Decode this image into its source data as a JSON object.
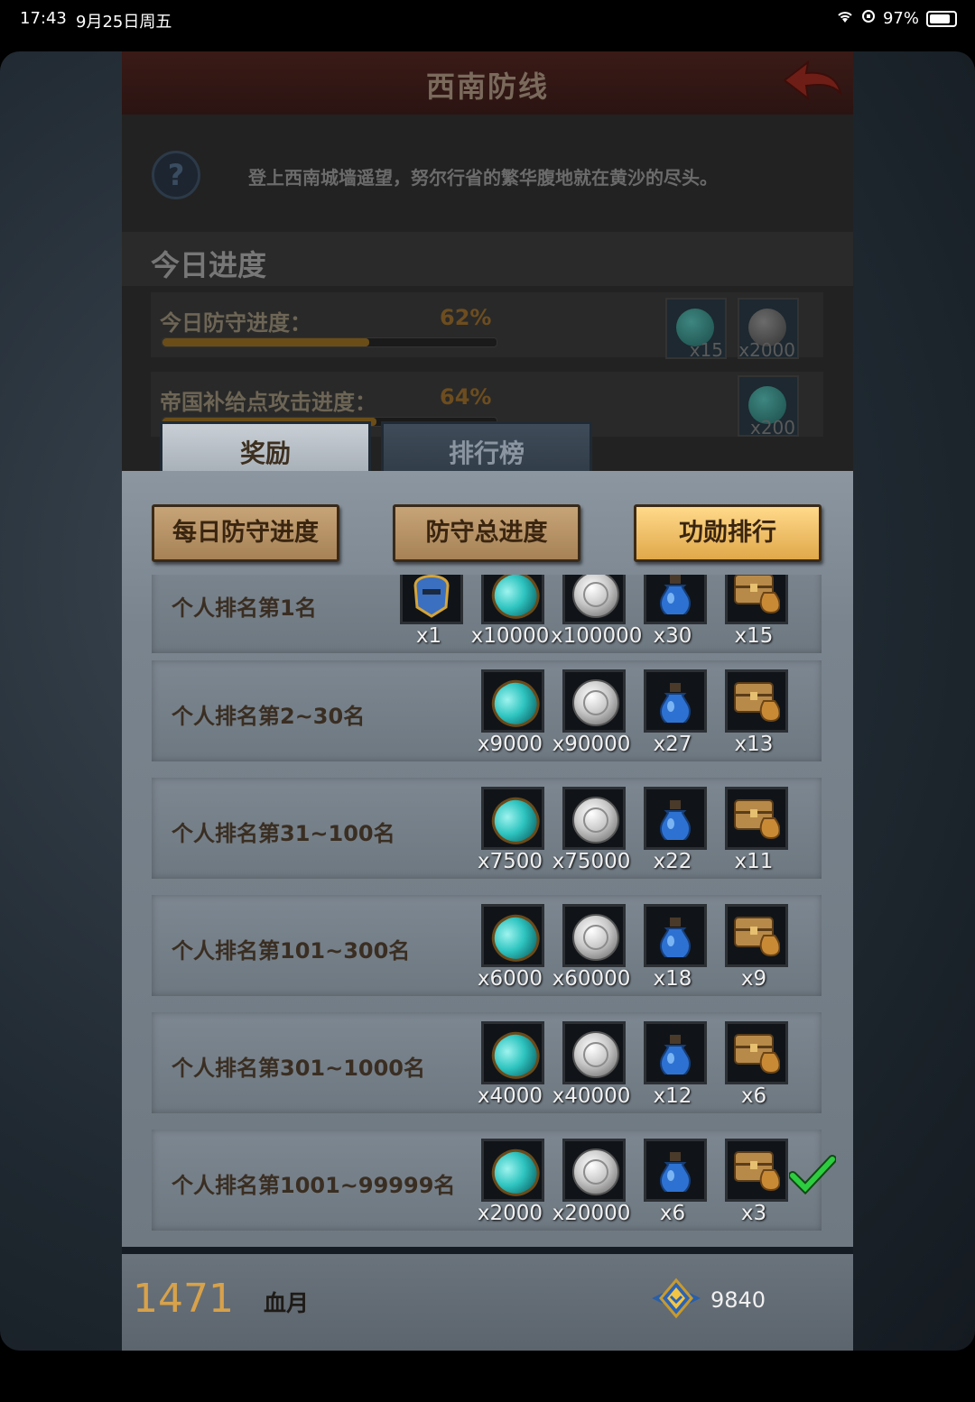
{
  "status_bar": {
    "time": "17:43",
    "date": "9月25日周五",
    "battery": "97%"
  },
  "header": {
    "title": "西南防线"
  },
  "description": "登上西南城墙遥望，努尔行省的繁华腹地就在黄沙的尽头。",
  "today_progress": {
    "title": "今日进度",
    "rows": [
      {
        "label": "今日防守进度：",
        "percent": "62%",
        "fill": 0.62,
        "rewards": [
          {
            "icon": "gem-icon",
            "qty": "x15"
          },
          {
            "icon": "silver-coin-icon",
            "qty": "x2000"
          }
        ]
      },
      {
        "label": "帝国补给点攻击进度：",
        "percent": "64%",
        "fill": 0.64,
        "rewards": [
          {
            "icon": "gem-icon",
            "qty": "x200"
          }
        ]
      }
    ]
  },
  "tabs": {
    "rewards": "奖励",
    "leaderboard": "排行榜"
  },
  "sub_buttons": {
    "daily": "每日防守进度",
    "total": "防守总进度",
    "merit": "功勋排行"
  },
  "rank_rewards": [
    {
      "label": "个人排名第1名",
      "items": [
        {
          "icon": "helmet-icon",
          "qty": "x1"
        },
        {
          "icon": "gem-icon",
          "qty": "x10000"
        },
        {
          "icon": "silver-coin-icon",
          "qty": "x100000"
        },
        {
          "icon": "potion-icon",
          "qty": "x30"
        },
        {
          "icon": "chest-icon",
          "qty": "x15"
        }
      ]
    },
    {
      "label": "个人排名第2~30名",
      "items": [
        {
          "icon": "gem-icon",
          "qty": "x9000"
        },
        {
          "icon": "silver-coin-icon",
          "qty": "x90000"
        },
        {
          "icon": "potion-icon",
          "qty": "x27"
        },
        {
          "icon": "chest-icon",
          "qty": "x13"
        }
      ]
    },
    {
      "label": "个人排名第31~100名",
      "items": [
        {
          "icon": "gem-icon",
          "qty": "x7500"
        },
        {
          "icon": "silver-coin-icon",
          "qty": "x75000"
        },
        {
          "icon": "potion-icon",
          "qty": "x22"
        },
        {
          "icon": "chest-icon",
          "qty": "x11"
        }
      ]
    },
    {
      "label": "个人排名第101~300名",
      "items": [
        {
          "icon": "gem-icon",
          "qty": "x6000"
        },
        {
          "icon": "silver-coin-icon",
          "qty": "x60000"
        },
        {
          "icon": "potion-icon",
          "qty": "x18"
        },
        {
          "icon": "chest-icon",
          "qty": "x9"
        }
      ]
    },
    {
      "label": "个人排名第301~1000名",
      "items": [
        {
          "icon": "gem-icon",
          "qty": "x4000"
        },
        {
          "icon": "silver-coin-icon",
          "qty": "x40000"
        },
        {
          "icon": "potion-icon",
          "qty": "x12"
        },
        {
          "icon": "chest-icon",
          "qty": "x6"
        }
      ]
    },
    {
      "label": "个人排名第1001~99999名",
      "items": [
        {
          "icon": "gem-icon",
          "qty": "x2000"
        },
        {
          "icon": "silver-coin-icon",
          "qty": "x20000"
        },
        {
          "icon": "potion-icon",
          "qty": "x6"
        },
        {
          "icon": "chest-icon",
          "qty": "x3"
        }
      ],
      "current": true
    }
  ],
  "footer": {
    "rank": "1471",
    "player_name": "血月",
    "merit": "9840"
  },
  "colors": {
    "accent_gold": "#d8a24a",
    "active_button": "#f0c070",
    "check_green": "#2ecc40"
  }
}
